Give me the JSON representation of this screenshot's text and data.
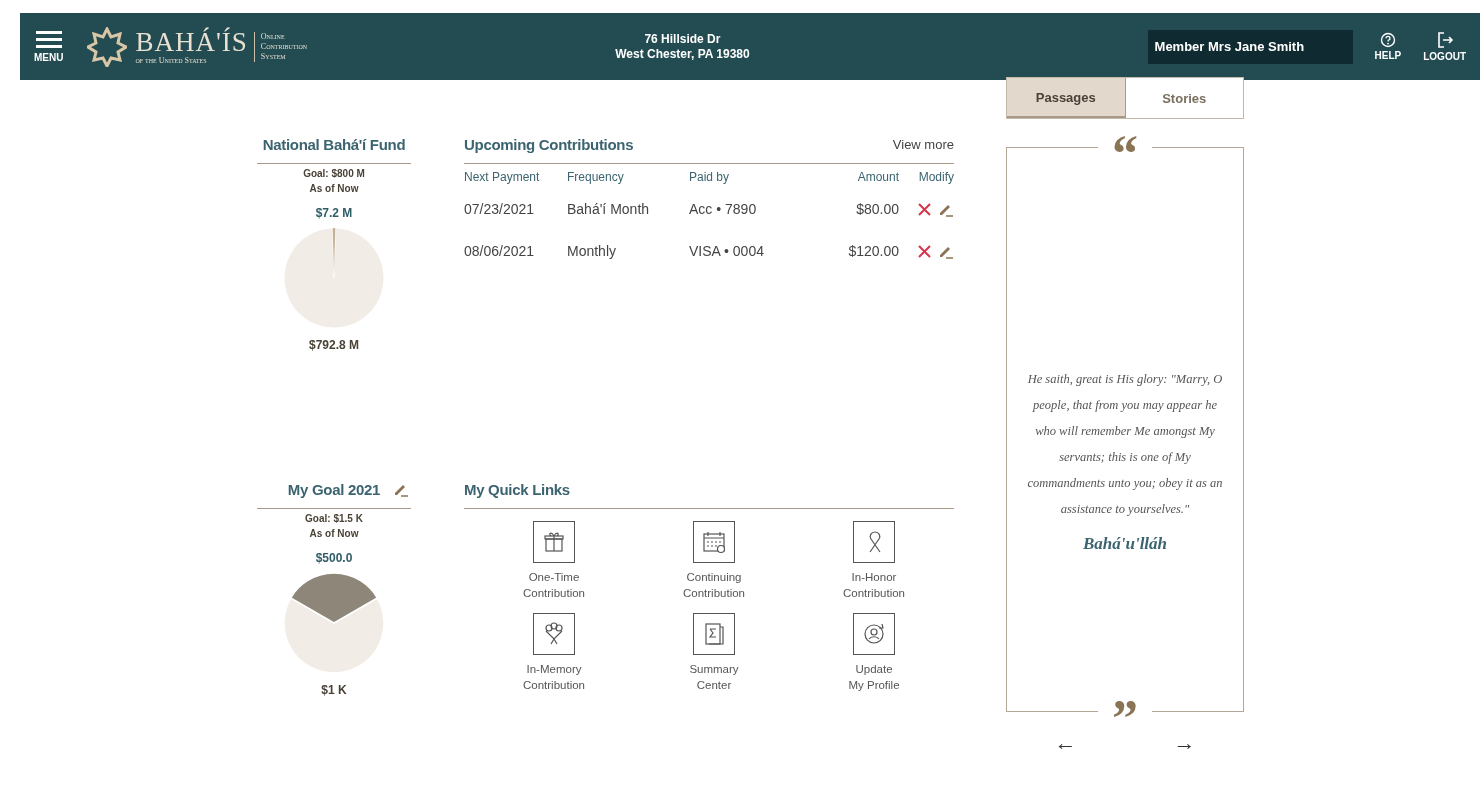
{
  "header": {
    "menu_label": "MENU",
    "logo_title": "BAHÁ'ÍS",
    "logo_subtitle": "of the United States",
    "system_name": [
      "Online",
      "Contribution",
      "System"
    ],
    "address": [
      "76 Hillside Dr",
      "West Chester, PA 19380"
    ],
    "member": "Member Mrs Jane Smith",
    "help": "HELP",
    "logout": "LOGOUT"
  },
  "fund": {
    "title": "National Bahá'í Fund",
    "goal": "Goal: $800 M",
    "as_of": "As of Now",
    "chart_data": {
      "type": "pie",
      "categories": [
        "$7.2 M",
        "$792.8 M"
      ],
      "values": [
        7.2,
        792.8
      ]
    }
  },
  "goal": {
    "title": "My Goal 2021",
    "goal": "Goal: $1.5 K",
    "as_of": "As of Now",
    "chart_data": {
      "type": "pie",
      "categories": [
        "$500.0",
        "$1 K"
      ],
      "values": [
        500,
        1000
      ]
    }
  },
  "upcoming": {
    "title": "Upcoming Contributions",
    "view_more": "View more",
    "columns": [
      "Next Payment",
      "Frequency",
      "Paid by",
      "Amount",
      "Modify"
    ],
    "rows": [
      {
        "date": "07/23/2021",
        "frequency": "Bahá'í Month",
        "paid_by": "Acc • 7890",
        "amount": "$80.00"
      },
      {
        "date": "08/06/2021",
        "frequency": "Monthly",
        "paid_by": "VISA • 0004",
        "amount": "$120.00"
      }
    ]
  },
  "quick_links": {
    "title": "My Quick Links",
    "items": [
      {
        "kind": "gift",
        "label": "One-Time\nContribution"
      },
      {
        "kind": "calendar",
        "label": "Continuing\nContribution"
      },
      {
        "kind": "ribbon",
        "label": "In-Honor\nContribution"
      },
      {
        "kind": "bouquet",
        "label": "In-Memory\nContribution"
      },
      {
        "kind": "summary",
        "label": "Summary\nCenter"
      },
      {
        "kind": "profile",
        "label": "Update\nMy Profile"
      }
    ]
  },
  "passages": {
    "tabs": [
      {
        "label": "Passages",
        "selected": true
      },
      {
        "label": "Stories",
        "selected": false
      }
    ],
    "open_quote": "“",
    "quote": "He saith, great is His glory: \"Marry, O people, that from you may appear he who will remember Me amongst My servants; this is one of My commandments unto you; obey it as an assistance to yourselves.\"",
    "author": "Bahá'u'lláh",
    "close_quote": "”",
    "prev": "←",
    "next": "→"
  }
}
